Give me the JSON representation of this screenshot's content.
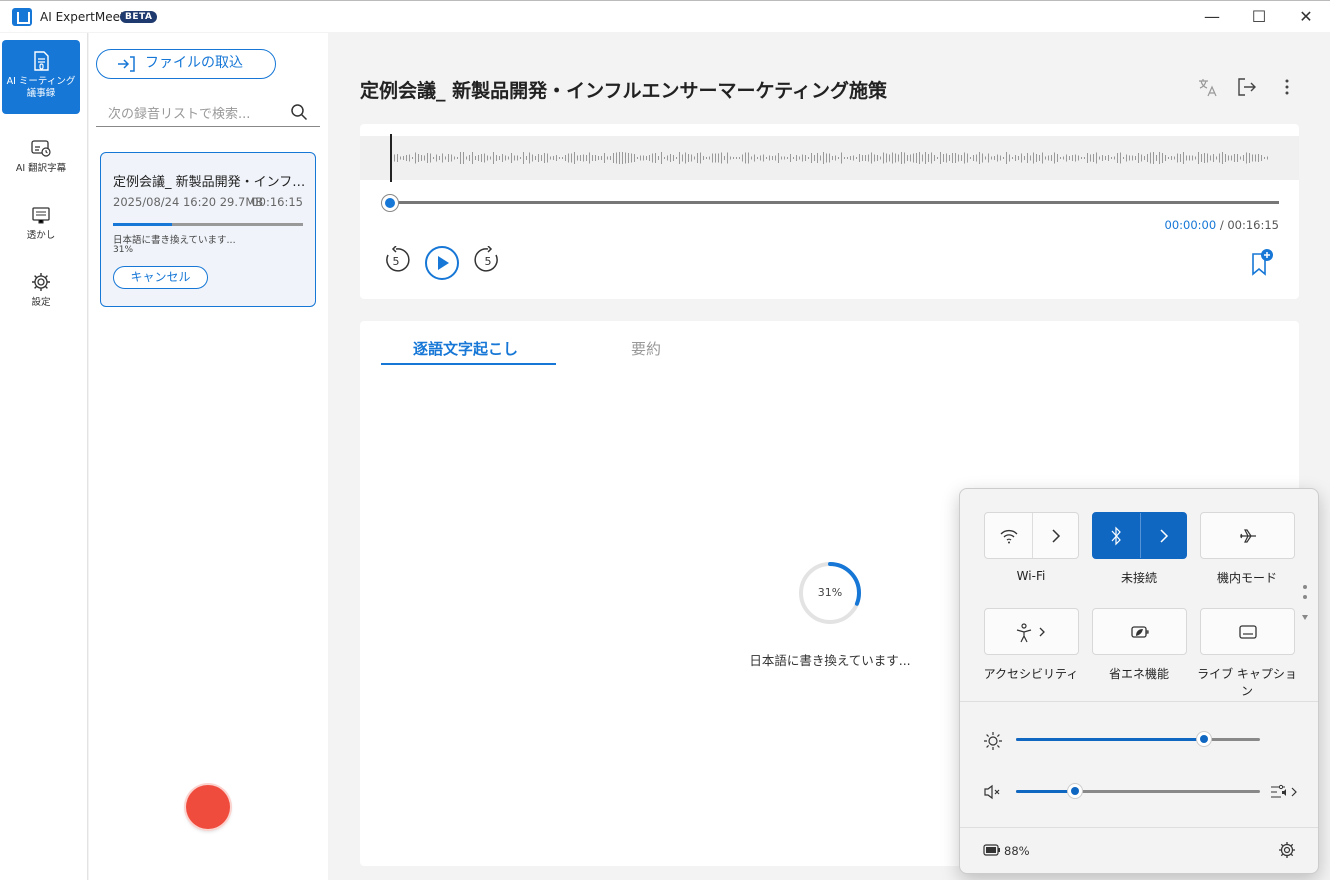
{
  "app": {
    "title": "AI ExpertMeet",
    "badge": "BETA"
  },
  "window": {
    "minimize": "—",
    "maximize": "☐",
    "close": "✕"
  },
  "nav": {
    "items": [
      {
        "label": "AI ミーティング議事録",
        "icon": "meeting-minutes-icon"
      },
      {
        "label": "AI 翻訳字幕",
        "icon": "subtitle-icon"
      },
      {
        "label": "透かし",
        "icon": "watermark-icon"
      },
      {
        "label": "設定",
        "icon": "gear-icon"
      }
    ]
  },
  "list": {
    "import_label": "ファイルの取込",
    "search_placeholder": "次の録音リストで検索...",
    "card": {
      "title": "定例会議_ 新製品開発・インフルエンサーマーケティング施策",
      "meta": "2025/08/24 16:20 29.7MB",
      "duration": "00:16:15",
      "progress": 0.31,
      "status": "日本語に書き換えています...",
      "percent": "31%",
      "cancel_label": "キャンセル"
    }
  },
  "main": {
    "title": "定例会議_ 新製品開発・インフルエンサーマーケティング施策",
    "player": {
      "current_time": "00:00:00",
      "separator": "/",
      "total_time": "00:16:15",
      "rewind_label": "5",
      "forward_label": "5"
    },
    "tabs": [
      {
        "label": "逐語文字起こし",
        "active": true
      },
      {
        "label": "要約",
        "active": false
      }
    ],
    "progress": {
      "value": 0.31,
      "label": "31%",
      "status": "日本語に書き換えています..."
    }
  },
  "quick_settings": {
    "tiles": [
      {
        "label": "Wi-Fi",
        "icon": "wifi-icon",
        "on": false
      },
      {
        "label": "未接続",
        "icon": "bluetooth-icon",
        "on": true
      },
      {
        "label": "機内モード",
        "icon": "airplane-icon",
        "on": false
      },
      {
        "label": "アクセシビリティ",
        "icon": "accessibility-icon",
        "on": false
      },
      {
        "label": "省エネ機能",
        "icon": "energy-saver-icon",
        "on": false
      },
      {
        "label": "ライブ キャプション",
        "icon": "live-caption-icon",
        "on": false
      }
    ],
    "brightness": 0.77,
    "volume": 0.24,
    "volume_muted": true,
    "battery": "88%"
  },
  "colors": {
    "accent": "#1677d6",
    "record": "#f04c3e",
    "qs_accent": "#1067c2"
  }
}
